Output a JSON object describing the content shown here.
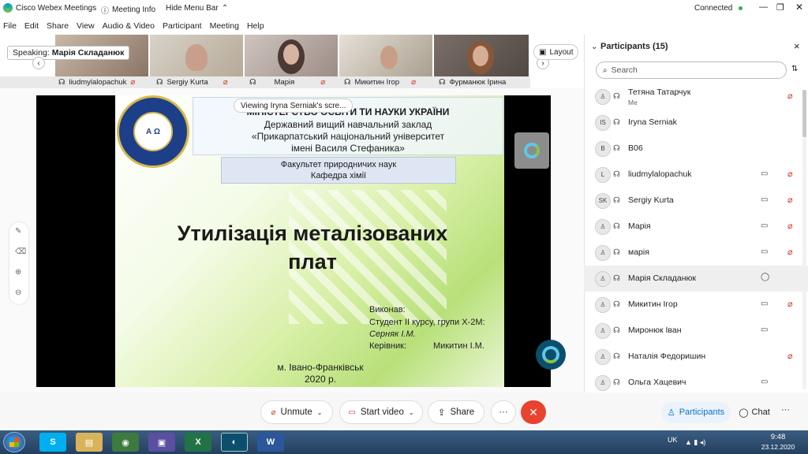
{
  "titlebar": {
    "app_name": "Cisco Webex Meetings",
    "meeting_info": "Meeting Info",
    "hide_menu_bar": "Hide Menu Bar",
    "status": "Connected"
  },
  "menu": [
    "File",
    "Edit",
    "Share",
    "View",
    "Audio & Video",
    "Participant",
    "Meeting",
    "Help"
  ],
  "speaking": {
    "label": "Speaking:",
    "name": "Марія Складанюк"
  },
  "layout_button": "Layout",
  "thumbnails": [
    "liudmylalopachuk",
    "Sergiy Kurta",
    "Марія",
    "Микитин Ігор",
    "Фурманюк Ірина"
  ],
  "viewing_banner": "Viewing Iryna Serniak's scre...",
  "slide": {
    "ministry": "МІНІСТЕРСТВО ОСВІТИ ТИ НАУКИ УКРАЇНИ",
    "institution_line1": "Державний вищий навчальний заклад",
    "institution_line2": "«Прикарпатський національний університет",
    "institution_line3": "імені Василя Стефаника»",
    "faculty": "Факультет природничих наук",
    "department": "Кафедра хімії",
    "title_line1": "Утилізація металізованих",
    "title_line2": "плат",
    "performed_label": "Виконав:",
    "student": "Студент II курсу, групи Х-2М:",
    "student_name": "Серняк І.М.",
    "supervisor_label": "Керівник:",
    "supervisor_name": "Микитин І.М.",
    "city": "м. Івано-Франківськ",
    "year": "2020 р."
  },
  "participants_panel": {
    "title": "Participants (15)",
    "search_placeholder": "Search",
    "list": [
      {
        "initials": "",
        "name": "Тетяна Татарчук",
        "sub": "Me",
        "cam": false,
        "mic": "muted"
      },
      {
        "initials": "IS",
        "name": "Iryna Serniak",
        "sub": "",
        "cam": false,
        "mic": ""
      },
      {
        "initials": "B",
        "name": "B06",
        "sub": "",
        "cam": false,
        "mic": ""
      },
      {
        "initials": "L",
        "name": "liudmylalopachuk",
        "sub": "",
        "cam": true,
        "mic": "muted"
      },
      {
        "initials": "SK",
        "name": "Sergiy Kurta",
        "sub": "",
        "cam": true,
        "mic": "muted"
      },
      {
        "initials": "",
        "name": "Марія",
        "sub": "",
        "cam": true,
        "mic": "muted"
      },
      {
        "initials": "",
        "name": "марія",
        "sub": "",
        "cam": true,
        "mic": "muted"
      },
      {
        "initials": "",
        "name": "Марія Складанюк",
        "sub": "",
        "cam": false,
        "mic": "speaking"
      },
      {
        "initials": "",
        "name": "Микитин Ігор",
        "sub": "",
        "cam": true,
        "mic": "muted"
      },
      {
        "initials": "",
        "name": "Миронюк Іван",
        "sub": "",
        "cam": true,
        "mic": ""
      },
      {
        "initials": "",
        "name": "Наталія Федоришин",
        "sub": "",
        "cam": false,
        "mic": "muted"
      },
      {
        "initials": "",
        "name": "Ольга Хацевич",
        "sub": "",
        "cam": true,
        "mic": ""
      }
    ]
  },
  "controls": {
    "unmute": "Unmute",
    "start_video": "Start video",
    "share": "Share",
    "more": "···",
    "participants": "Participants",
    "chat": "Chat"
  },
  "taskbar": {
    "language": "UK",
    "time": "9:48",
    "date": "23.12.2020"
  },
  "colors": {
    "accent_blue": "#1170cf",
    "end_red": "#e8432f",
    "mute_red": "#d13b2a",
    "connected_green": "#2fb34a"
  }
}
